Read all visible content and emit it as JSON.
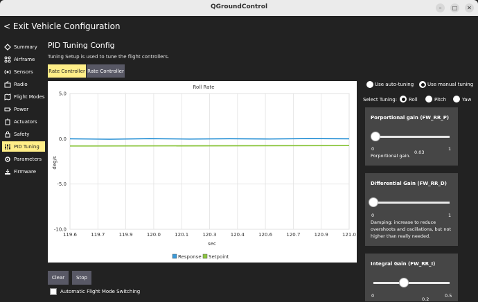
{
  "window": {
    "title": "QGroundControl"
  },
  "toolbar": {
    "exit_label": "< Exit Vehicle Configuration"
  },
  "sidebar": {
    "items": [
      {
        "label": "Summary",
        "icon": "summary-icon"
      },
      {
        "label": "Airframe",
        "icon": "airframe-icon"
      },
      {
        "label": "Sensors",
        "icon": "sensors-icon"
      },
      {
        "label": "Radio",
        "icon": "radio-icon"
      },
      {
        "label": "Flight Modes",
        "icon": "flight-modes-icon"
      },
      {
        "label": "Power",
        "icon": "power-icon"
      },
      {
        "label": "Actuators",
        "icon": "actuators-icon"
      },
      {
        "label": "Safety",
        "icon": "safety-icon"
      },
      {
        "label": "PID Tuning",
        "icon": "pid-tuning-icon",
        "active": true
      },
      {
        "label": "Parameters",
        "icon": "parameters-icon"
      },
      {
        "label": "Firmware",
        "icon": "firmware-icon"
      }
    ]
  },
  "main": {
    "title": "PID Tuning Config",
    "subtitle": "Tuning Setup is used to tune the flight controllers.",
    "tabs": [
      {
        "label": "Rate Controller",
        "active": true
      },
      {
        "label": "Rate Controller",
        "active": false
      }
    ]
  },
  "tuning_mode": {
    "auto_label": "Use auto-tuning",
    "manual_label": "Use manual tuning",
    "selected": "manual"
  },
  "select_tuning": {
    "label": "Select Tuning:",
    "options": [
      "Roll",
      "Pitch",
      "Yaw"
    ],
    "selected": "Roll"
  },
  "gains": [
    {
      "title": "Porportional gain (FW_RR_P)",
      "min": "0",
      "max": "1",
      "value": "0.03",
      "value_num": 0.03,
      "description": "Porportional gain."
    },
    {
      "title": "Differential Gain (FW_RR_D)",
      "min": "0",
      "max": "1",
      "value": "",
      "value_num": 0.0,
      "description": "Damping: increase to reduce overshoots and oscillations, but not higher than really needed."
    },
    {
      "title": "Integral Gain (FW_RR_I)",
      "min": "0",
      "max": "0.5",
      "value": "0.2",
      "value_num": 0.2,
      "description": ""
    }
  ],
  "buttons": {
    "clear_label": "Clear",
    "stop_label": "Stop"
  },
  "auto_switch": {
    "label": "Automatic Flight Mode Switching",
    "checked": false
  },
  "colors": {
    "accent": "#ffee88",
    "response": "#3a9ad9",
    "setpoint": "#8cc63f"
  },
  "chart_data": {
    "type": "line",
    "title": "Roll Rate",
    "xlabel": "sec",
    "ylabel": "deg/s",
    "xlim": [
      119.6,
      121.0
    ],
    "ylim": [
      -10.0,
      5.0
    ],
    "x_ticks": [
      "119.6",
      "119.7",
      "119.9",
      "120.0",
      "120.1",
      "120.3",
      "120.4",
      "120.6",
      "120.7",
      "120.9",
      "121.0"
    ],
    "y_ticks": [
      "5.0",
      "0.0",
      "-5.0",
      "-10.0"
    ],
    "y_tick_values": [
      5.0,
      0.0,
      -5.0,
      -10.0
    ],
    "grid": true,
    "legend": "bottom-center",
    "series": [
      {
        "name": "Response",
        "color": "#3a9ad9",
        "x": [
          119.6,
          119.8,
          120.0,
          120.2,
          120.4,
          120.6,
          120.8,
          121.0
        ],
        "values": [
          0.0,
          -0.05,
          0.02,
          -0.03,
          0.01,
          -0.02,
          0.03,
          0.0
        ]
      },
      {
        "name": "Setpoint",
        "color": "#8cc63f",
        "x": [
          119.6,
          121.0
        ],
        "values": [
          -0.8,
          -0.75
        ]
      }
    ]
  }
}
